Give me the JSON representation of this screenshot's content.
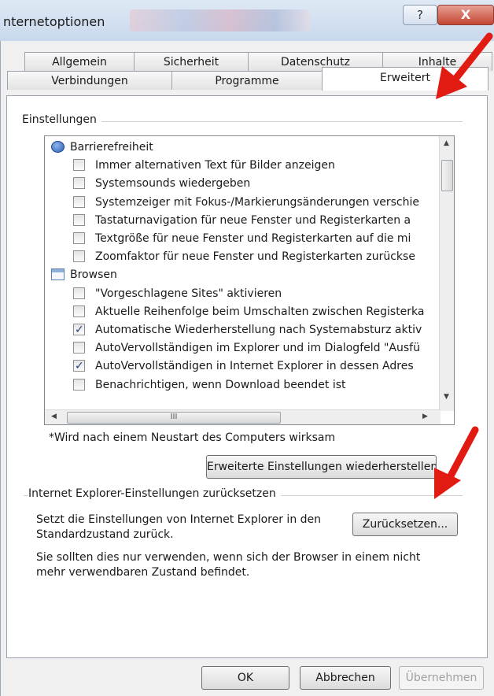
{
  "window": {
    "title": "nternetoptionen",
    "help_label": "?",
    "close_label": "X"
  },
  "tabs_back": [
    "Allgemein",
    "Sicherheit",
    "Datenschutz",
    "Inhalte"
  ],
  "tabs_front": [
    "Verbindungen",
    "Programme",
    "Erweitert"
  ],
  "settings": {
    "group_label": "Einstellungen",
    "items": [
      {
        "type": "category",
        "icon": "accessibility-icon",
        "label": "Barrierefreiheit"
      },
      {
        "type": "checkbox",
        "checked": false,
        "label": "Immer alternativen Text für Bilder anzeigen"
      },
      {
        "type": "checkbox",
        "checked": false,
        "label": "Systemsounds wiedergeben"
      },
      {
        "type": "checkbox",
        "checked": false,
        "label": "Systemzeiger mit Fokus-/Markierungsänderungen verschie"
      },
      {
        "type": "checkbox",
        "checked": false,
        "label": "Tastaturnavigation für neue Fenster und Registerkarten a"
      },
      {
        "type": "checkbox",
        "checked": false,
        "label": "Textgröße für neue Fenster und Registerkarten auf die mi"
      },
      {
        "type": "checkbox",
        "checked": false,
        "label": "Zoomfaktor für neue Fenster und Registerkarten zurückse"
      },
      {
        "type": "category",
        "icon": "browse-window-icon",
        "label": "Browsen"
      },
      {
        "type": "checkbox",
        "checked": false,
        "label": "\"Vorgeschlagene Sites\" aktivieren"
      },
      {
        "type": "checkbox",
        "checked": false,
        "label": "Aktuelle Reihenfolge beim Umschalten zwischen Registerka"
      },
      {
        "type": "checkbox",
        "checked": true,
        "label": "Automatische Wiederherstellung nach Systemabsturz aktiv"
      },
      {
        "type": "checkbox",
        "checked": false,
        "label": "AutoVervollständigen im Explorer und im Dialogfeld \"Ausfü"
      },
      {
        "type": "checkbox",
        "checked": true,
        "label": "AutoVervollständigen in Internet Explorer in dessen Adres"
      },
      {
        "type": "checkbox",
        "checked": false,
        "label": "Benachrichtigen, wenn Download beendet ist"
      }
    ],
    "hscroll_grip": "III",
    "restart_note": "*Wird nach einem Neustart des Computers wirksam",
    "restore_button": "Erweiterte Einstellungen wiederherstellen"
  },
  "reset": {
    "group_label": "Internet Explorer-Einstellungen zurücksetzen",
    "description_line1": "Setzt die Einstellungen von Internet Explorer in den",
    "description_line2": "Standardzustand zurück.",
    "button": "Zurücksetzen...",
    "note_line1": "Sie sollten dies nur verwenden, wenn sich der Browser in einem nicht",
    "note_line2": "mehr verwendbaren Zustand befindet."
  },
  "footer": {
    "ok": "OK",
    "cancel": "Abbrechen",
    "apply": "Übernehmen"
  },
  "colors": {
    "annotation_arrow": "#e21b12"
  }
}
